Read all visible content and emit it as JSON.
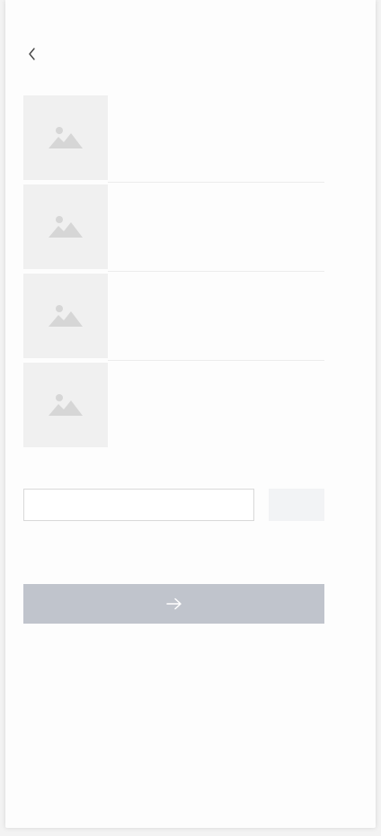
{
  "header": {
    "back_icon": "chevron-left-icon"
  },
  "items": [
    {
      "image_icon": "image-placeholder-icon",
      "label": ""
    },
    {
      "image_icon": "image-placeholder-icon",
      "label": ""
    },
    {
      "image_icon": "image-placeholder-icon",
      "label": ""
    },
    {
      "image_icon": "image-placeholder-icon",
      "label": ""
    }
  ],
  "form": {
    "input_value": "",
    "input_placeholder": "",
    "side_button_label": ""
  },
  "submit": {
    "icon": "arrow-right-icon",
    "color": "#c0c4cc"
  },
  "colors": {
    "placeholder_bg": "#f0f0f0",
    "placeholder_icon": "#d6d6d6",
    "side_button_bg": "#f2f3f5"
  }
}
